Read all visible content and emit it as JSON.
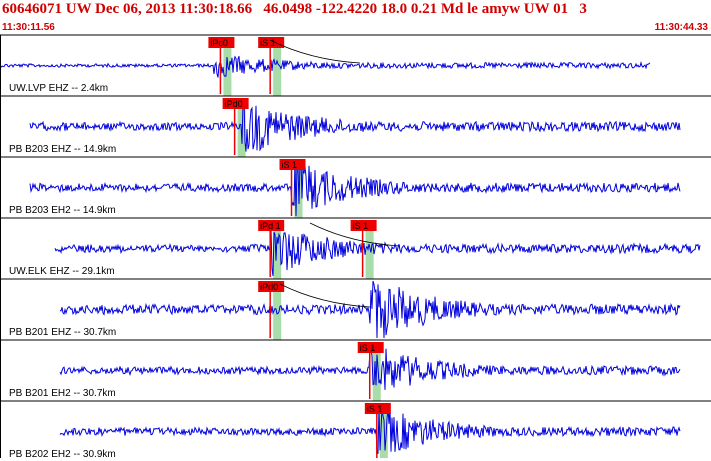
{
  "header": {
    "title": "60646071 UW Dec 06, 2013 11:30:18.66   46.0498 -122.4220 18.0 0.21 Md le amyw UW 01   3",
    "time_start": "11:30:11.56",
    "time_end": "11:30:44.33"
  },
  "colors": {
    "trace": "#0000dd",
    "pick": "#ee0000",
    "pick_band": "#a8dca8",
    "divider": "#000000",
    "title": "#d00000"
  },
  "channels": [
    {
      "label": "UW.LVP EHZ -- 2.4km",
      "picks": [
        {
          "label": "iPc0",
          "t": 0.31
        },
        {
          "label": "iS 1",
          "t": 0.38
        }
      ],
      "onset": 0.3,
      "amplitude": 0.25
    },
    {
      "label": "PB B203 EHZ -- 14.9km",
      "picks": [
        {
          "label": "iPd0",
          "t": 0.33
        }
      ],
      "onset": 0.34,
      "amplitude": 0.6
    },
    {
      "label": "PB B203 EH2 -- 14.9km",
      "picks": [
        {
          "label": "iS 1",
          "t": 0.41
        }
      ],
      "onset": 0.41,
      "amplitude": 0.6
    },
    {
      "label": "UW.ELK EHZ -- 29.1km",
      "picks": [
        {
          "label": "iPd 1",
          "t": 0.38
        },
        {
          "label": "iS 1",
          "t": 0.51
        }
      ],
      "onset": 0.38,
      "amplitude": 0.55
    },
    {
      "label": "PB B201 EHZ -- 30.7km",
      "picks": [
        {
          "label": "iPd0",
          "t": 0.38
        }
      ],
      "onset": 0.52,
      "amplitude": 0.7
    },
    {
      "label": "PB B201 EH2 -- 30.7km",
      "picks": [
        {
          "label": "iS 1",
          "t": 0.52
        }
      ],
      "onset": 0.52,
      "amplitude": 0.55
    },
    {
      "label": "PB B202 EH2 -- 30.9km",
      "picks": [
        {
          "label": "iS 1",
          "t": 0.53
        }
      ],
      "onset": 0.53,
      "amplitude": 0.55
    }
  ]
}
